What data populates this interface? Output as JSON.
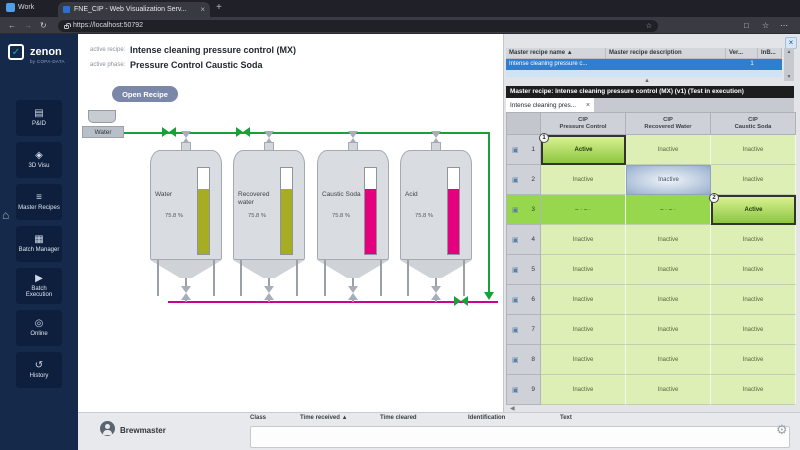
{
  "browser": {
    "profile": "Work",
    "tab_title": "FNE_CIP - Web Visualization Serv...",
    "url": "https://localhost:50792"
  },
  "icons": {
    "close": "×",
    "new_tab": "+",
    "back": "←",
    "forward": "→",
    "refresh": "↻",
    "star": "☆",
    "more": "⋯",
    "window": "□",
    "gear": "⚙",
    "sort_asc": "▲",
    "scroll_up": "▲",
    "scroll_down": "▼",
    "scroll_left": "◀",
    "collapse": "▲",
    "check": "✓",
    "row_icon": "▣",
    "plant": "⌂"
  },
  "sidebar": {
    "brand": "zenon",
    "brand_sub": "by COPA-DATA",
    "items": [
      {
        "id": "pid",
        "label": "P&ID",
        "icon": "▤"
      },
      {
        "id": "3d-visu",
        "label": "3D Visu",
        "icon": "◈"
      },
      {
        "id": "master-recipes",
        "label": "Master Recipes",
        "icon": "≡"
      },
      {
        "id": "batch-manager",
        "label": "Batch Manager",
        "icon": "▦"
      },
      {
        "id": "batch-execution",
        "label": "Batch Execution",
        "icon": "▶"
      },
      {
        "id": "online",
        "label": "Online",
        "icon": "◎"
      },
      {
        "id": "history",
        "label": "History",
        "icon": "↺"
      }
    ]
  },
  "main": {
    "active_recipe_label": "active recipe:",
    "active_recipe": "Intense cleaning pressure control (MX)",
    "active_phase_label": "active phase:",
    "active_phase": "Pressure Control Caustic Soda",
    "open_recipe_button": "Open Recipe",
    "source_label": "Water",
    "pipe_colors": {
      "supply": "#18a136",
      "return": "#cf0090"
    },
    "tanks": [
      {
        "name": "Water",
        "level": "75.8 %",
        "color": "#a6ad23"
      },
      {
        "name": "Recovered water",
        "level": "75.8 %",
        "color": "#a6ad23"
      },
      {
        "name": "Caustic Soda",
        "level": "75.8 %",
        "color": "#e5007d"
      },
      {
        "name": "Acid",
        "level": "75.8 %",
        "color": "#e5007d"
      }
    ]
  },
  "recipes_panel": {
    "table": {
      "headers": [
        "Master recipe name",
        "Master recipe description",
        "Ver...",
        "InB..."
      ],
      "selected_row": {
        "name": "Intense cleaning pressure c...",
        "version": "1"
      }
    },
    "title_bar": "Master recipe: Intense cleaning pressure control (MX) (v1) (Test in execution)",
    "tab_label": "Intense cleaning pres...",
    "matrix": {
      "columns": [
        {
          "line1": "CIP",
          "line2": "Pressure Control"
        },
        {
          "line1": "CIP",
          "line2": "Recovered Water"
        },
        {
          "line1": "CIP",
          "line2": "Caustic Soda"
        }
      ],
      "rows": [
        {
          "num": "1",
          "state": "normal",
          "cells": [
            {
              "text": "Active",
              "state": "active",
              "badge": "1"
            },
            {
              "text": "Inactive",
              "state": "inactive"
            },
            {
              "text": "Inactive",
              "state": "inactive"
            }
          ]
        },
        {
          "num": "2",
          "state": "normal",
          "cells": [
            {
              "text": "Inactive",
              "state": "inactive"
            },
            {
              "text": "Inactive",
              "state": "selected"
            },
            {
              "text": "Inactive",
              "state": "inactive"
            }
          ]
        },
        {
          "num": "3",
          "state": "current",
          "cells": [
            {
              "text": "– · – ·",
              "state": "current"
            },
            {
              "text": "– · – ·",
              "state": "current"
            },
            {
              "text": "Active",
              "state": "active",
              "badge": "2"
            }
          ]
        },
        {
          "num": "4",
          "state": "normal",
          "cells": [
            {
              "text": "Inactive",
              "state": "inactive"
            },
            {
              "text": "Inactive",
              "state": "inactive"
            },
            {
              "text": "Inactive",
              "state": "inactive"
            }
          ]
        },
        {
          "num": "5",
          "state": "normal",
          "cells": [
            {
              "text": "Inactive",
              "state": "inactive"
            },
            {
              "text": "Inactive",
              "state": "inactive"
            },
            {
              "text": "Inactive",
              "state": "inactive"
            }
          ]
        },
        {
          "num": "6",
          "state": "normal",
          "cells": [
            {
              "text": "Inactive",
              "state": "inactive"
            },
            {
              "text": "Inactive",
              "state": "inactive"
            },
            {
              "text": "Inactive",
              "state": "inactive"
            }
          ]
        },
        {
          "num": "7",
          "state": "normal",
          "cells": [
            {
              "text": "Inactive",
              "state": "inactive"
            },
            {
              "text": "Inactive",
              "state": "inactive"
            },
            {
              "text": "Inactive",
              "state": "inactive"
            }
          ]
        },
        {
          "num": "8",
          "state": "normal",
          "cells": [
            {
              "text": "Inactive",
              "state": "inactive"
            },
            {
              "text": "Inactive",
              "state": "inactive"
            },
            {
              "text": "Inactive",
              "state": "inactive"
            }
          ]
        },
        {
          "num": "9",
          "state": "normal",
          "cells": [
            {
              "text": "Inactive",
              "state": "inactive"
            },
            {
              "text": "Inactive",
              "state": "inactive"
            },
            {
              "text": "Inactive",
              "state": "inactive"
            }
          ]
        }
      ]
    }
  },
  "bottom_bar": {
    "user": "Brewmaster",
    "alarm_headers": [
      "Class",
      "Time received",
      "Time cleared",
      "Identification",
      "Text"
    ]
  }
}
